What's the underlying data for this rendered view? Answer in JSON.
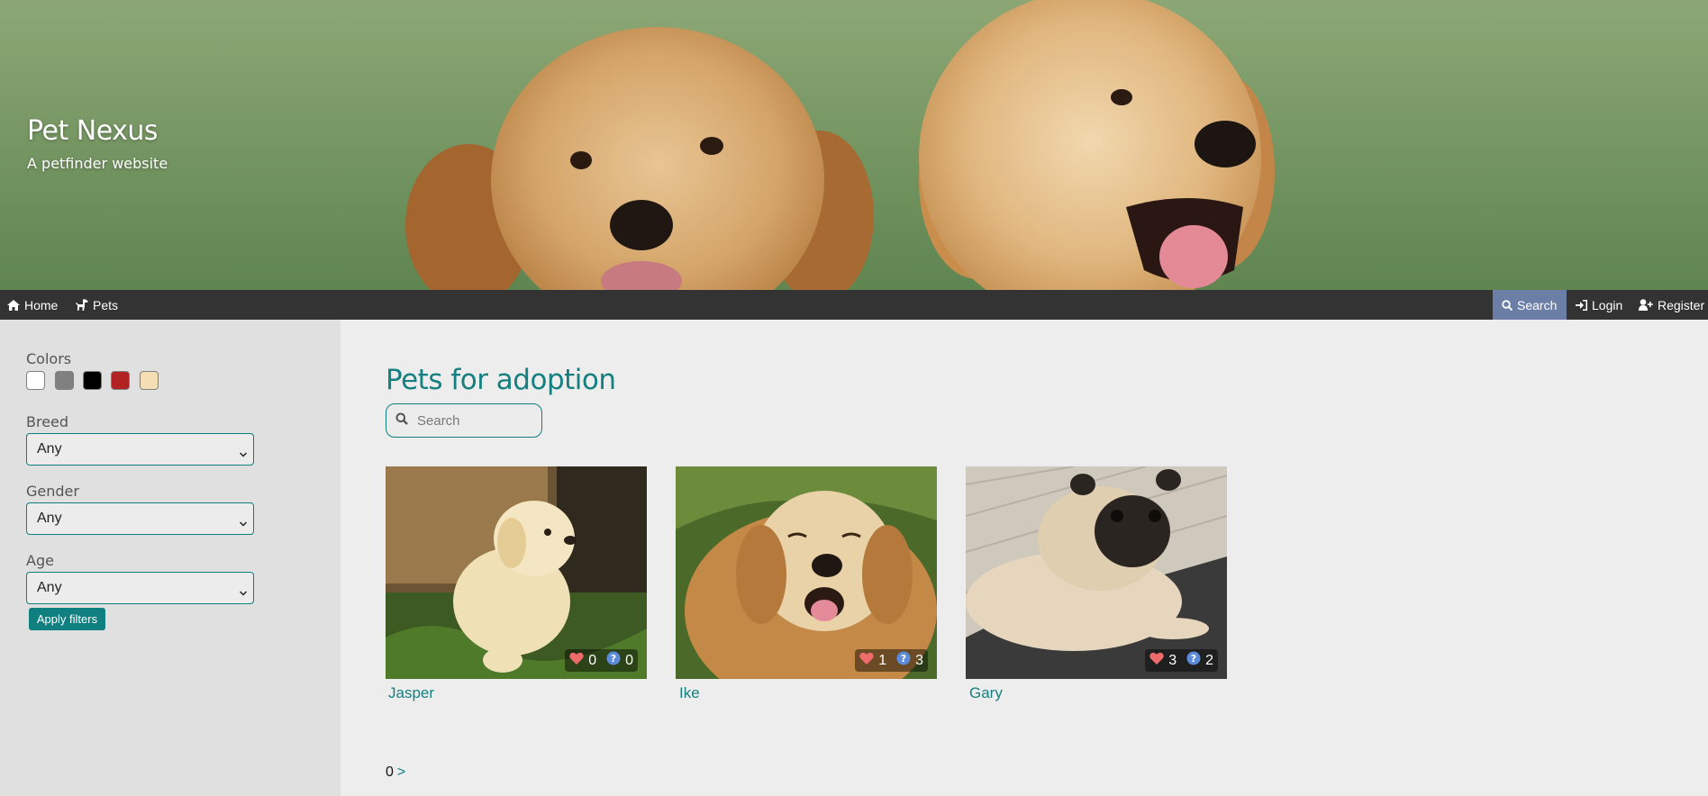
{
  "site": {
    "title": "Pet Nexus",
    "subtitle": "A petfinder website"
  },
  "nav": {
    "home": "Home",
    "pets": "Pets",
    "search": "Search",
    "login": "Login",
    "register": "Register"
  },
  "filters": {
    "colors_label": "Colors",
    "colors": [
      "#ffffff",
      "#808080",
      "#000000",
      "#b22222",
      "#f5deb3"
    ],
    "breed_label": "Breed",
    "breed_value": "Any",
    "gender_label": "Gender",
    "gender_value": "Any",
    "age_label": "Age",
    "age_value": "Any",
    "apply_label": "Apply filters"
  },
  "main": {
    "title": "Pets for adoption",
    "search_placeholder": "Search"
  },
  "pets": [
    {
      "name": "Jasper",
      "likes": "0",
      "questions": "0"
    },
    {
      "name": "Ike",
      "likes": "1",
      "questions": "3"
    },
    {
      "name": "Gary",
      "likes": "3",
      "questions": "2"
    }
  ],
  "pagination": {
    "current": "0",
    "next": ">"
  },
  "icons": {
    "home": "home-icon",
    "pets": "dog-icon",
    "search": "search-icon",
    "login": "sign-in-icon",
    "register": "user-plus-icon",
    "like": "heart-icon",
    "question": "question-circle-icon"
  }
}
